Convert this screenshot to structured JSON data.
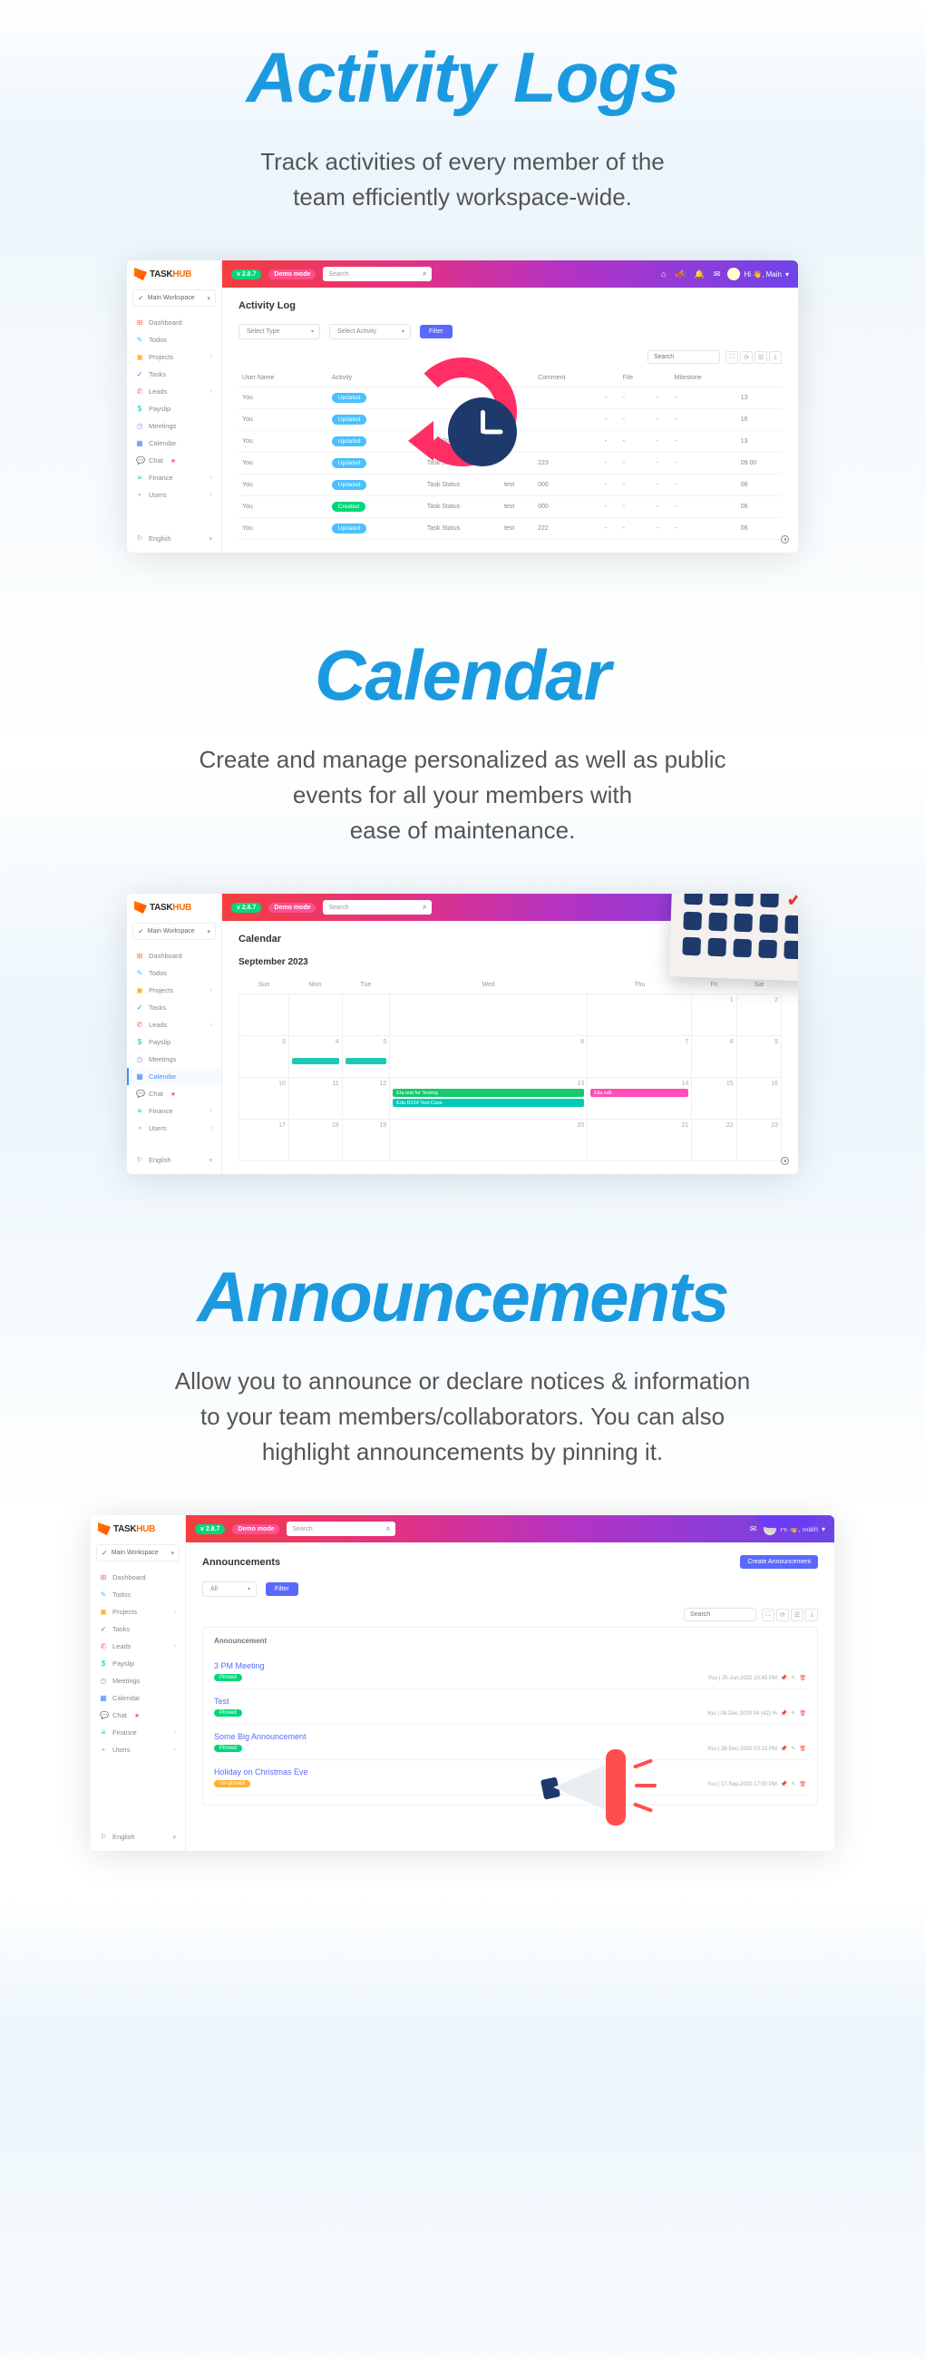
{
  "sections": {
    "activity": {
      "title": "Activity Logs",
      "subtitle_l1": "Track activities of every member of the",
      "subtitle_l2": "team efficiently workspace-wide."
    },
    "calendar": {
      "title": "Calendar",
      "subtitle_l1": "Create and manage personalized as well as public",
      "subtitle_l2": "events for all your members with",
      "subtitle_l3": "ease of maintenance."
    },
    "announcements": {
      "title": "Announcements",
      "subtitle_l1": "Allow you to announce or declare notices & information",
      "subtitle_l2": "to your team members/collaborators. You can also",
      "subtitle_l3": "highlight announcements by pinning it."
    }
  },
  "brand": {
    "task": "TASK",
    "hub": "HUB"
  },
  "topbar": {
    "version": "v 2.8.7",
    "demo": "Demo mode",
    "search_placeholder": "Search",
    "user_greeting": "Hi 👋, Main",
    "caret": "▾"
  },
  "workspace": {
    "label": "Main Workspace",
    "caret": "▾",
    "check": "✓"
  },
  "sidebar_items": [
    {
      "icon": "⊞",
      "label": "Dashboard",
      "color": "#ff6a4d"
    },
    {
      "icon": "✎",
      "label": "Todos",
      "color": "#4bc0ff"
    },
    {
      "icon": "▣",
      "label": "Projects",
      "color": "#ffb02e",
      "arrow": true
    },
    {
      "icon": "✓",
      "label": "Tasks",
      "color": "#5969ff"
    },
    {
      "icon": "✆",
      "label": "Leads",
      "color": "#ff4e8e",
      "arrow": true
    },
    {
      "icon": "$",
      "label": "Payslip",
      "color": "#00c9b7"
    },
    {
      "icon": "◷",
      "label": "Meetings",
      "color": "#b37bff"
    },
    {
      "icon": "▦",
      "label": "Calendar",
      "color": "#3f8cff"
    },
    {
      "icon": "💬",
      "label": "Chat",
      "color": "#555",
      "star": true
    },
    {
      "icon": "≡",
      "label": "Finance",
      "color": "#00c9b7",
      "arrow": true
    },
    {
      "icon": "⚬",
      "label": "Users",
      "color": "#999",
      "arrow": true
    }
  ],
  "sidebar_footer": {
    "icon": "⚐",
    "label": "English",
    "caret": "▾"
  },
  "activity_page": {
    "heading": "Activity Log",
    "select_type": "Select Type",
    "select_activity": "Select Activity",
    "filter_btn": "Filter",
    "search_placeholder": "Search",
    "cols": [
      "User Name",
      "",
      "Activity",
      "",
      "Type",
      "",
      "Comment",
      "",
      "File",
      "",
      "Milestone",
      "",
      ""
    ],
    "col_un": "User Name",
    "col_ac": "Activity",
    "col_ty": "Type",
    "col_co": "Comment",
    "col_fi": "File",
    "col_mi": "Milestone",
    "rows": [
      {
        "user": "You",
        "badge": "Updated",
        "badge_cls": "updated",
        "type": "",
        "a": "test",
        "b": "",
        "c": "-",
        "d": "-",
        "e": "-",
        "f": "13"
      },
      {
        "user": "You",
        "badge": "Updated",
        "badge_cls": "updated",
        "type": "",
        "a": "test",
        "b": "",
        "c": "-",
        "d": "-",
        "e": "-",
        "f": "16"
      },
      {
        "user": "You",
        "badge": "Updated",
        "badge_cls": "updated",
        "type": "Task Status",
        "a": "test",
        "b": "",
        "c": "-",
        "d": "-",
        "e": "-",
        "f": "13"
      },
      {
        "user": "You",
        "badge": "Updated",
        "badge_cls": "updated",
        "type": "Task Status",
        "a": "",
        "b": "223",
        "c": "-",
        "d": "-",
        "e": "-",
        "f": "09 00"
      },
      {
        "user": "You",
        "badge": "Updated",
        "badge_cls": "updated",
        "type": "Task Status",
        "a": "test",
        "b": "000",
        "c": "-",
        "d": "-",
        "e": "-",
        "f": "06"
      },
      {
        "user": "You",
        "badge": "Created",
        "badge_cls": "created",
        "type": "Task Status",
        "a": "test",
        "b": "000",
        "c": "-",
        "d": "-",
        "e": "-",
        "f": "06"
      },
      {
        "user": "You",
        "badge": "Updated",
        "badge_cls": "updated",
        "type": "Task Status",
        "a": "test",
        "b": "222",
        "c": "-",
        "d": "-",
        "e": "-",
        "f": "06"
      }
    ]
  },
  "calendar_page": {
    "heading": "Calendar",
    "month": "September 2023",
    "days": [
      "Sun",
      "Mon",
      "Tue",
      "Wed",
      "Thu",
      "Fri",
      "Sat"
    ],
    "grid": [
      [
        {
          "n": "",
          "other": true
        },
        {
          "n": "",
          "other": true
        },
        {
          "n": "",
          "other": true
        },
        {
          "n": "",
          "other": true
        },
        {
          "n": "",
          "other": true
        },
        {
          "n": "1"
        },
        {
          "n": "2"
        }
      ],
      [
        {
          "n": "3"
        },
        {
          "n": "4",
          "tealbar": true
        },
        {
          "n": "5",
          "tealbar": true
        },
        {
          "n": "6"
        },
        {
          "n": "7"
        },
        {
          "n": "8"
        },
        {
          "n": "9"
        }
      ],
      [
        {
          "n": "10"
        },
        {
          "n": "11"
        },
        {
          "n": "12"
        },
        {
          "n": "13",
          "ev1": "Eta test for Testing",
          "ev2": "Eda R234 Test Case"
        },
        {
          "n": "14",
          "ev3": "Ella edit"
        },
        {
          "n": "15"
        },
        {
          "n": "16"
        }
      ],
      [
        {
          "n": "17"
        },
        {
          "n": "18"
        },
        {
          "n": "19"
        },
        {
          "n": "20"
        },
        {
          "n": "21"
        },
        {
          "n": "22"
        },
        {
          "n": "23"
        }
      ]
    ]
  },
  "ann_page": {
    "heading": "Announcements",
    "create_btn": "Create Announcement",
    "all": "All",
    "filter_btn": "Filter",
    "search_placeholder": "Search",
    "card_title": "Announcement",
    "items": [
      {
        "title": "3 PM Meeting",
        "tag": "Pinned",
        "tag_cls": "pinned",
        "meta": "You | 25-Jun-2022 10:45 PM"
      },
      {
        "title": "Test",
        "tag": "Pinned",
        "tag_cls": "pinned",
        "meta": "You | 08-Dec-2020 04 (42) %"
      },
      {
        "title": "Some Big Announcement",
        "tag": "Pinned",
        "tag_cls": "pinned",
        "meta": "You | 28-Dec-2020 03:23 PM"
      },
      {
        "title": "Holiday on Christmas Eve",
        "tag": "Un-pinned",
        "tag_cls": "unpinned",
        "meta": "You | 17-Sep-2020 17:00 PM"
      }
    ]
  }
}
